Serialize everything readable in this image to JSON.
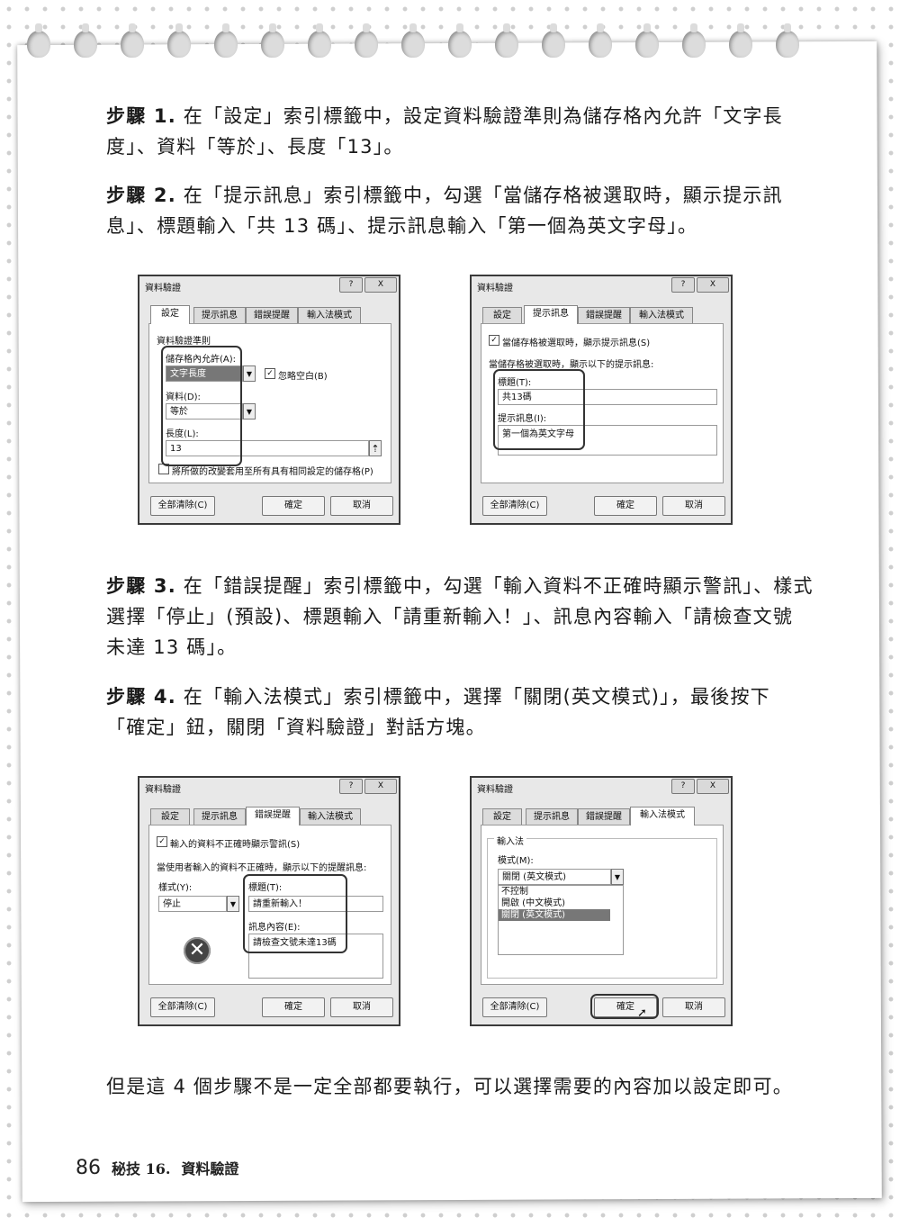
{
  "steps": [
    {
      "label": "步驟 1.",
      "lines": [
        "在「設定」索引標籤中，設定資料驗證準則為儲存格內允許「文字長",
        "度」、資料「等於」、長度「13」。"
      ]
    },
    {
      "label": "步驟 2.",
      "lines": [
        "在「提示訊息」索引標籤中，勾選「當儲存格被選取時，顯示提示訊",
        "息」、標題輸入「共 13 碼」、提示訊息輸入「第一個為英文字母」。"
      ]
    },
    {
      "label": "步驟 3.",
      "lines": [
        "在「錯誤提醒」索引標籤中，勾選「輸入資料不正確時顯示警訊」、樣式",
        "選擇「停止」(預設)、標題輸入「請重新輸入！」、訊息內容輸入「請檢查文號",
        "未達 13 碼」。"
      ]
    },
    {
      "label": "步驟 4.",
      "lines": [
        "在「輸入法模式」索引標籤中，選擇「關閉(英文模式)」，最後按下",
        "「確定」鈕，關閉「資料驗證」對話方塊。"
      ]
    }
  ],
  "closing": "但是這 4 個步驟不是一定全部都要執行，可以選擇需要的內容加以設定即可。",
  "footer": {
    "page": "86",
    "section": "秘技 16.",
    "title": "資料驗證"
  },
  "dialog_common": {
    "title": "資料驗證",
    "help": "?",
    "close": "X",
    "tabs": [
      "設定",
      "提示訊息",
      "錯誤提醒",
      "輸入法模式"
    ],
    "clear_all": "全部清除(C)",
    "ok": "確定",
    "cancel": "取消"
  },
  "d1": {
    "criteria": "資料驗證準則",
    "allow_label": "儲存格內允許(A):",
    "allow_value": "文字長度",
    "ignore_blank": "忽略空白(B)",
    "data_label": "資料(D):",
    "data_value": "等於",
    "length_label": "長度(L):",
    "length_value": "13",
    "apply_all": "將所做的改變套用至所有具有相同設定的儲存格(P)"
  },
  "d2": {
    "show_input": "當儲存格被選取時，顯示提示訊息(S)",
    "when_selected": "當儲存格被選取時，顯示以下的提示訊息:",
    "title_label": "標題(T):",
    "title_value": "共13碼",
    "msg_label": "提示訊息(I):",
    "msg_value": "第一個為英文字母"
  },
  "d3": {
    "show_error": "輸入的資料不正確時顯示警訊(S)",
    "when_invalid": "當使用者輸入的資料不正確時，顯示以下的提醒訊息:",
    "style_label": "樣式(Y):",
    "style_value": "停止",
    "title_label": "標題(T):",
    "title_value": "請重新輸入！",
    "msg_label": "訊息內容(E):",
    "msg_value": "請檢查文號未達13碼"
  },
  "d4": {
    "ime_group": "輸入法",
    "mode_label": "模式(M):",
    "mode_value": "關閉 (英文模式)",
    "options": [
      "不控制",
      "開啟 (中文模式)",
      "關閉 (英文模式)"
    ]
  }
}
